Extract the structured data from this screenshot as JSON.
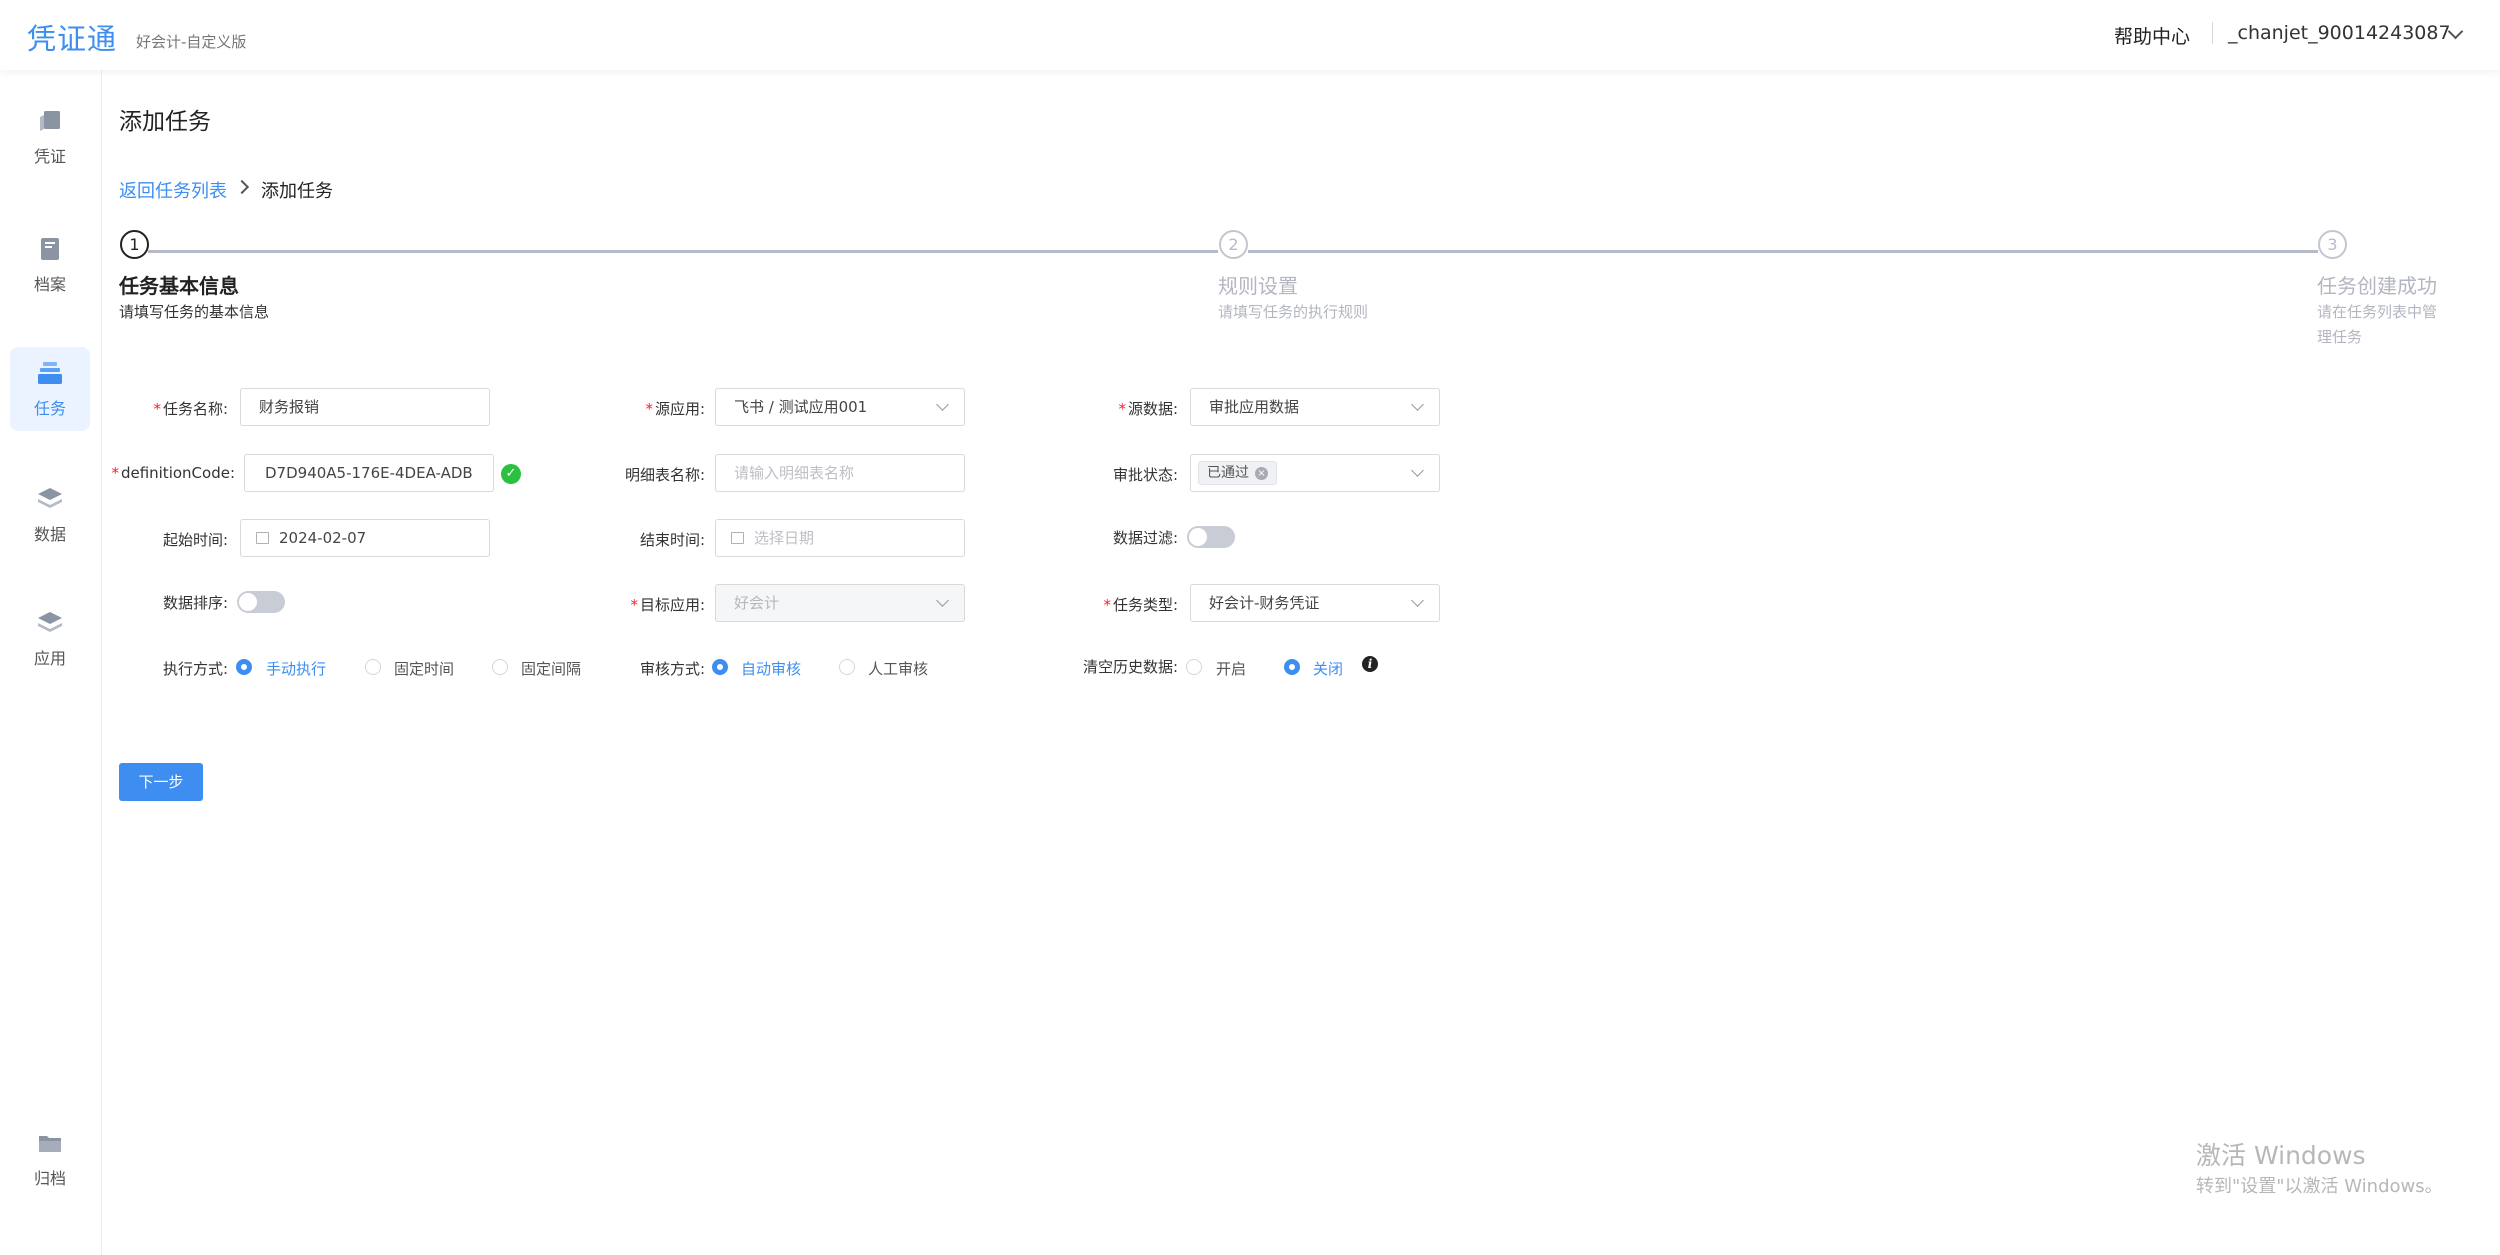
{
  "header": {
    "logo": "凭证通",
    "edition": "好会计-自定义版",
    "help": "帮助中心",
    "user": "_chanjet_90014243087"
  },
  "sidebar": {
    "items": [
      {
        "label": "凭证",
        "icon": "voucher-icon"
      },
      {
        "label": "档案",
        "icon": "archive-book-icon"
      },
      {
        "label": "任务",
        "icon": "task-stack-icon",
        "active": true
      },
      {
        "label": "数据",
        "icon": "data-layers-icon"
      },
      {
        "label": "应用",
        "icon": "app-layers-icon"
      },
      {
        "label": "归档",
        "icon": "folder-icon"
      }
    ]
  },
  "page": {
    "title": "添加任务",
    "breadcrumb": {
      "back": "返回任务列表",
      "current": "添加任务"
    }
  },
  "steps": [
    {
      "num": "1",
      "title": "任务基本信息",
      "desc": "请填写任务的基本信息",
      "status": "current"
    },
    {
      "num": "2",
      "title": "规则设置",
      "desc": "请填写任务的执行规则",
      "status": "wait"
    },
    {
      "num": "3",
      "title": "任务创建成功",
      "desc": "请在任务列表中管理任务",
      "status": "wait"
    }
  ],
  "form": {
    "task_name": {
      "label": "任务名称:",
      "value": "财务报销"
    },
    "source_app": {
      "label": "源应用:",
      "value": "飞书 / 测试应用001"
    },
    "source_data": {
      "label": "源数据:",
      "value": "审批应用数据"
    },
    "definition_code": {
      "label": "definitionCode:",
      "value": "D7D940A5-176E-4DEA-ADB"
    },
    "detail_table": {
      "label": "明细表名称:",
      "placeholder": "请输入明细表名称"
    },
    "approval_status": {
      "label": "审批状态:",
      "tag": "已通过"
    },
    "start_time": {
      "label": "起始时间:",
      "value": "2024-02-07"
    },
    "end_time": {
      "label": "结束时间:",
      "placeholder": "选择日期"
    },
    "data_filter": {
      "label": "数据过滤:",
      "on": false
    },
    "data_sort": {
      "label": "数据排序:",
      "on": false
    },
    "target_app": {
      "label": "目标应用:",
      "value": "好会计"
    },
    "task_type": {
      "label": "任务类型:",
      "value": "好会计-财务凭证"
    },
    "exec_mode": {
      "label": "执行方式:",
      "options": [
        "手动执行",
        "固定时间",
        "固定间隔"
      ],
      "selected": "手动执行"
    },
    "review_mode": {
      "label": "审核方式:",
      "options": [
        "自动审核",
        "人工审核"
      ],
      "selected": "自动审核"
    },
    "clear_history": {
      "label": "清空历史数据:",
      "options": [
        "开启",
        "关闭"
      ],
      "selected": "关闭"
    }
  },
  "actions": {
    "next": "下一步"
  },
  "watermark": {
    "line1": "激活 Windows",
    "line2": "转到\"设置\"以激活 Windows。"
  }
}
